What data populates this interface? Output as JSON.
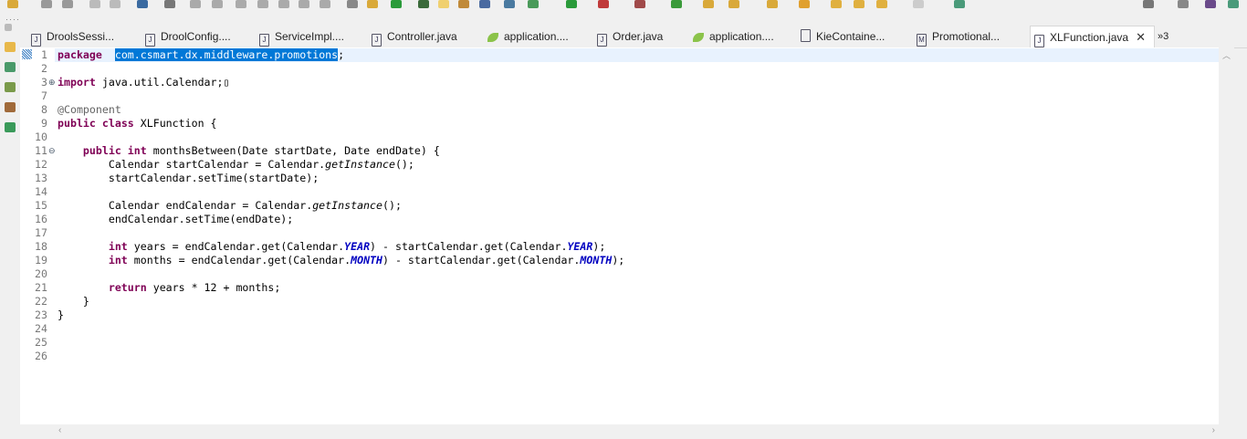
{
  "tabs": [
    {
      "label": "DroolsSessi...",
      "icon": "java-file-icon"
    },
    {
      "label": "DroolConfig....",
      "icon": "java-file-icon"
    },
    {
      "label": "ServiceImpl....",
      "icon": "java-file-icon"
    },
    {
      "label": "Controller.java",
      "icon": "java-file-icon"
    },
    {
      "label": "application....",
      "icon": "spring-leaf-icon"
    },
    {
      "label": "Order.java",
      "icon": "java-file-icon"
    },
    {
      "label": "application....",
      "icon": "spring-leaf-icon"
    },
    {
      "label": "KieContaine...",
      "icon": "class-file-icon"
    },
    {
      "label": "Promotional...",
      "icon": "maven-file-icon"
    },
    {
      "label": "XLFunction.java",
      "icon": "java-file-icon",
      "active": true
    }
  ],
  "tab_overflow": "»3",
  "tab_close": "✕",
  "colors": {
    "keyword": "#7f0055",
    "annotation": "#646464",
    "static_field": "#0000c0",
    "selection": "#0078d7",
    "current_line": "#e8f2fe"
  },
  "lines": [
    {
      "n": "1",
      "t": [
        [
          "kw",
          "package"
        ],
        [
          "",
          "  "
        ],
        [
          "sel",
          "com.csmart.dx.middleware.promotions"
        ],
        [
          "",
          ";"
        ]
      ]
    },
    {
      "n": "2",
      "t": []
    },
    {
      "n": "3",
      "fold": "+",
      "t": [
        [
          "kw",
          "import"
        ],
        [
          "",
          " java.util.Calendar;▯"
        ]
      ]
    },
    {
      "n": "7",
      "t": []
    },
    {
      "n": "8",
      "t": [
        [
          "an",
          "@Component"
        ]
      ]
    },
    {
      "n": "9",
      "t": [
        [
          "kw",
          "public"
        ],
        [
          "",
          " "
        ],
        [
          "kw",
          "class"
        ],
        [
          "",
          " XLFunction {"
        ]
      ]
    },
    {
      "n": "10",
      "t": []
    },
    {
      "n": "11",
      "fold": "-",
      "t": [
        [
          "",
          "    "
        ],
        [
          "kw",
          "public"
        ],
        [
          "",
          " "
        ],
        [
          "kw",
          "int"
        ],
        [
          "",
          " monthsBetween(Date startDate, Date endDate) {"
        ]
      ]
    },
    {
      "n": "12",
      "t": [
        [
          "",
          "        Calendar startCalendar = Calendar."
        ],
        [
          "sm",
          "getInstance"
        ],
        [
          "",
          "();"
        ]
      ]
    },
    {
      "n": "13",
      "t": [
        [
          "",
          "        startCalendar.setTime(startDate);"
        ]
      ]
    },
    {
      "n": "14",
      "t": []
    },
    {
      "n": "15",
      "t": [
        [
          "",
          "        Calendar endCalendar = Calendar."
        ],
        [
          "sm",
          "getInstance"
        ],
        [
          "",
          "();"
        ]
      ]
    },
    {
      "n": "16",
      "t": [
        [
          "",
          "        endCalendar.setTime(endDate);"
        ]
      ]
    },
    {
      "n": "17",
      "t": []
    },
    {
      "n": "18",
      "t": [
        [
          "",
          "        "
        ],
        [
          "kw",
          "int"
        ],
        [
          "",
          " years = endCalendar.get(Calendar."
        ],
        [
          "sf",
          "YEAR"
        ],
        [
          "",
          ") - startCalendar.get(Calendar."
        ],
        [
          "sf",
          "YEAR"
        ],
        [
          "",
          ");"
        ]
      ]
    },
    {
      "n": "19",
      "t": [
        [
          "",
          "        "
        ],
        [
          "kw",
          "int"
        ],
        [
          "",
          " months = endCalendar.get(Calendar."
        ],
        [
          "sf",
          "MONTH"
        ],
        [
          "",
          ") - startCalendar.get(Calendar."
        ],
        [
          "sf",
          "MONTH"
        ],
        [
          "",
          ");"
        ]
      ]
    },
    {
      "n": "20",
      "t": []
    },
    {
      "n": "21",
      "t": [
        [
          "",
          "        "
        ],
        [
          "kw",
          "return"
        ],
        [
          "",
          " years * 12 + months;"
        ]
      ]
    },
    {
      "n": "22",
      "t": [
        [
          "",
          "    }"
        ]
      ]
    },
    {
      "n": "23",
      "t": [
        [
          "",
          "}"
        ]
      ]
    },
    {
      "n": "24",
      "t": []
    },
    {
      "n": "25",
      "t": []
    },
    {
      "n": "26",
      "t": []
    }
  ]
}
